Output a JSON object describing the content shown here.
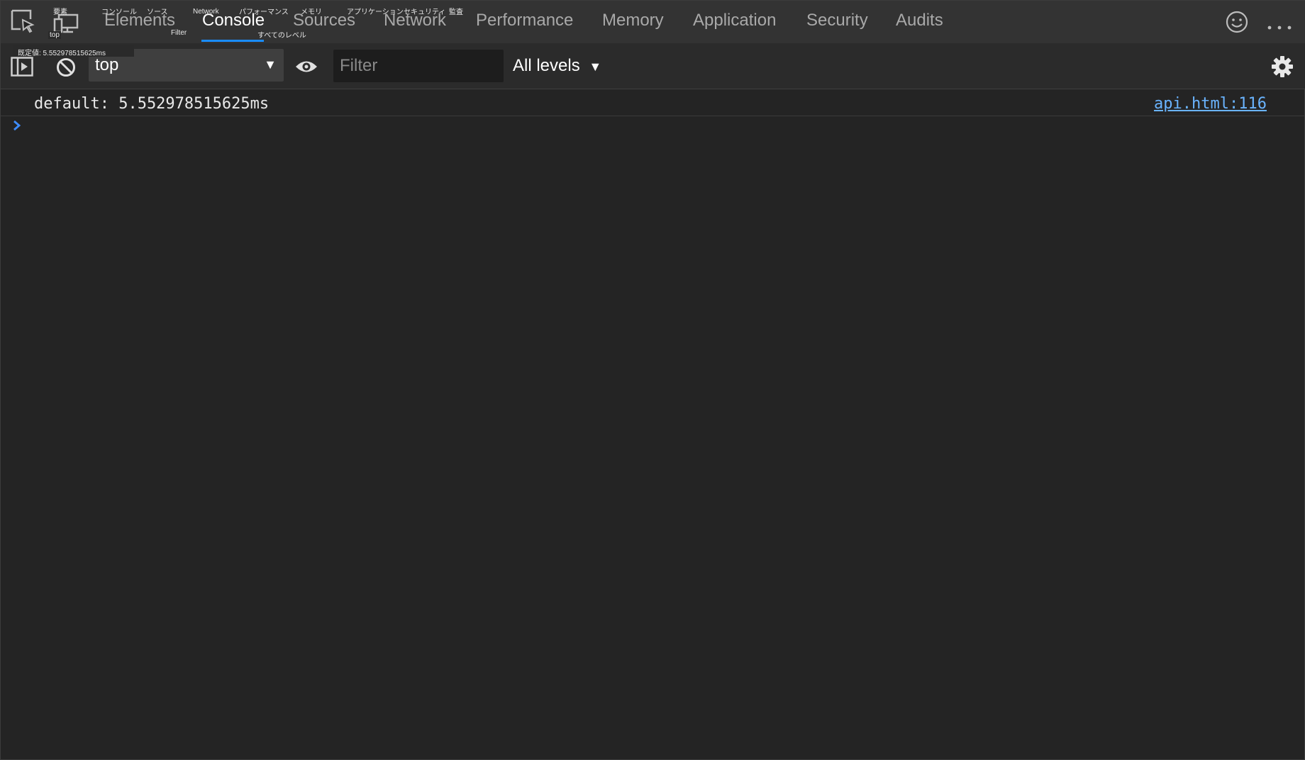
{
  "tabs": [
    {
      "label": "Elements",
      "ja": "要素",
      "active": false
    },
    {
      "label": "Console",
      "ja": "コンソール",
      "active": true
    },
    {
      "label": "Sources",
      "ja": "ソース",
      "active": false
    },
    {
      "label": "Network",
      "ja": "Network",
      "active": false
    },
    {
      "label": "Performance",
      "ja": "パフォーマンス",
      "active": false
    },
    {
      "label": "Memory",
      "ja": "メモリ",
      "active": false
    },
    {
      "label": "Application",
      "ja": "アプリケーション",
      "active": false
    },
    {
      "label": "Security",
      "ja": "セキュリティ",
      "active": false
    },
    {
      "label": "Audits",
      "ja": "監査",
      "active": false
    }
  ],
  "overlays": {
    "device_label": "top",
    "filter_label": "Filter",
    "all_levels_ja": "すべてのレベル",
    "default_ja": "既定値: 5.552978515625ms"
  },
  "toolbar": {
    "context": "top",
    "filter_placeholder": "Filter",
    "levels": "All levels"
  },
  "console": {
    "message": "default: 5.552978515625ms",
    "source": "api.html:116"
  },
  "colors": {
    "accent": "#1a8cff",
    "link": "#6ab4ff",
    "prompt": "#3d8cff"
  }
}
